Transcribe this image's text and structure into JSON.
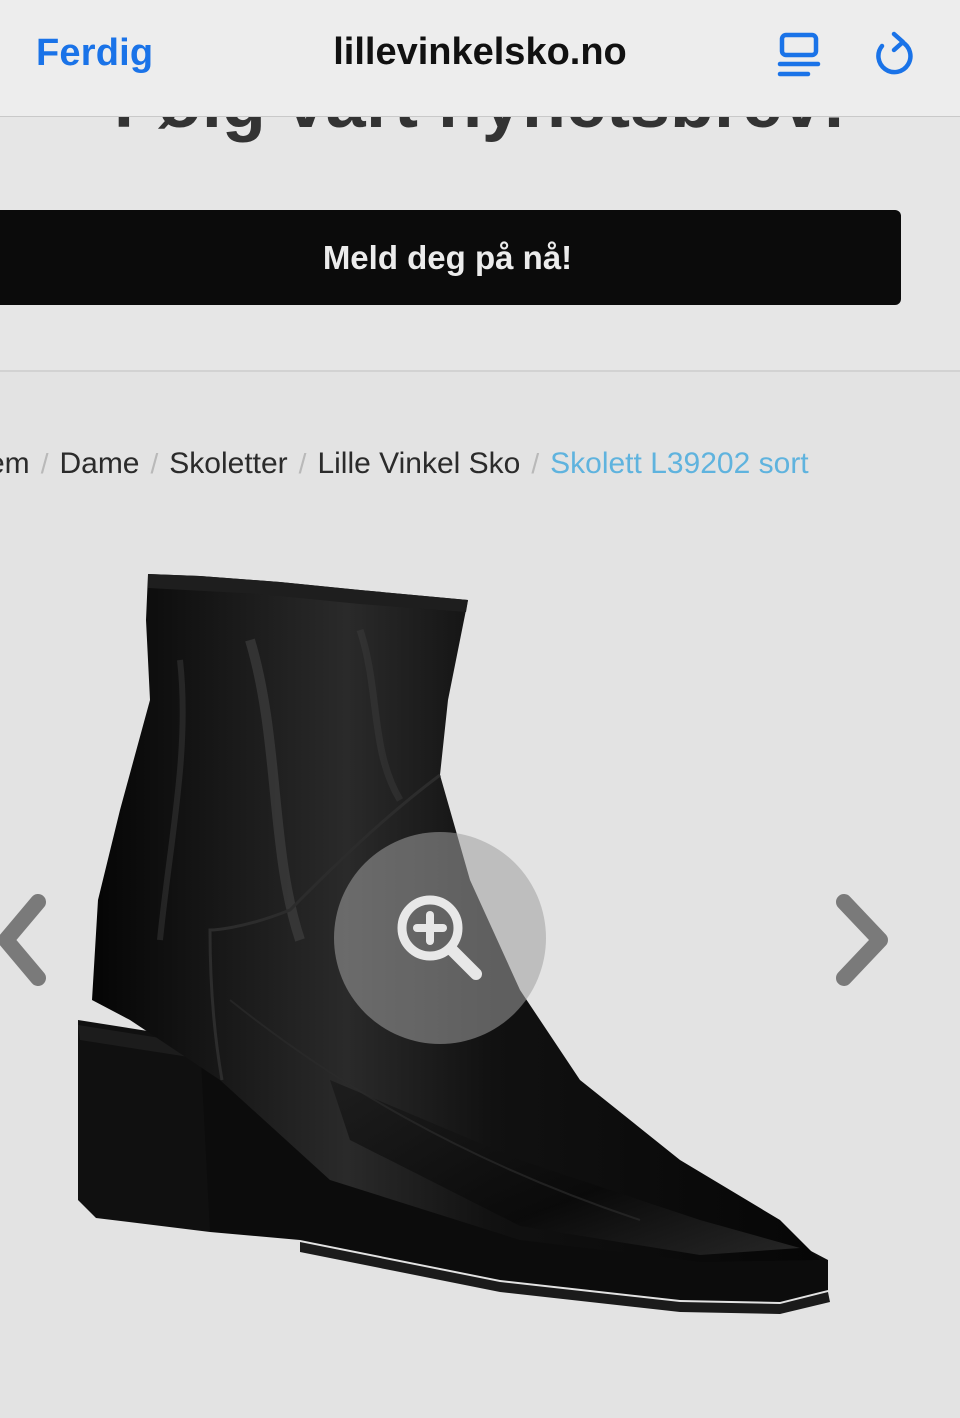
{
  "browser": {
    "done_label": "Ferdig",
    "domain": "lillevinkelsko.no",
    "reader_icon": "reader-mode-icon",
    "reload_icon": "reload-icon",
    "accent_color": "#1a73e8"
  },
  "newsletter": {
    "heading": "Følg vårt nyhetsbrev!",
    "button_label": "Meld deg på nå!"
  },
  "breadcrumb": {
    "items": [
      "em",
      "Dame",
      "Skoletter",
      "Lille Vinkel Sko"
    ],
    "current": "Skolett L39202 sort",
    "separator": "/",
    "current_color": "#5fb3de"
  },
  "gallery": {
    "image_alt": "Black leather ankle boot",
    "zoom_icon": "zoom-in-icon",
    "prev_icon": "chevron-left-icon",
    "next_icon": "chevron-right-icon"
  }
}
